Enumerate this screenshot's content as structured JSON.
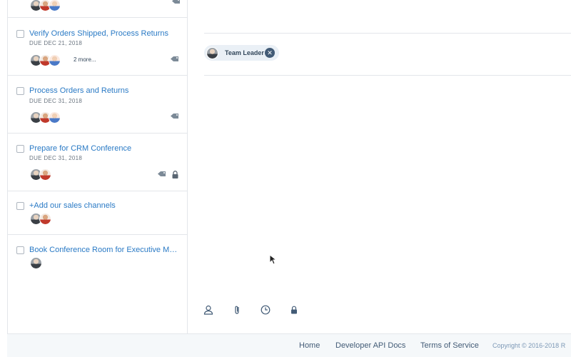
{
  "tasks": [
    {
      "title": "",
      "due": "",
      "more": ""
    },
    {
      "title": "Verify Orders Shipped, Process Returns",
      "due": "DUE DEC 21, 2018",
      "more": "2 more..."
    },
    {
      "title": "Process Orders and Returns",
      "due": "DUE DEC 31, 2018",
      "more": ""
    },
    {
      "title": "Prepare for CRM Conference",
      "due": "DUE DEC 31, 2018",
      "more": ""
    },
    {
      "title": "+Add our sales channels",
      "due": "",
      "more": ""
    },
    {
      "title": "Book Conference Room for Executive Meet…",
      "due": "",
      "more": ""
    }
  ],
  "detail": {
    "chip_label": "Team Leader",
    "toolbar_icons": [
      "person-icon",
      "paperclip-icon",
      "clock-icon",
      "lock-icon"
    ]
  },
  "footer": {
    "home": "Home",
    "api_docs": "Developer API Docs",
    "terms": "Terms of Service",
    "copyright": "Copyright © 2016-2018 R"
  },
  "colors": {
    "link": "#2a7ac5",
    "border": "#e3e6ea",
    "footer_bg": "#f5f8fa"
  }
}
